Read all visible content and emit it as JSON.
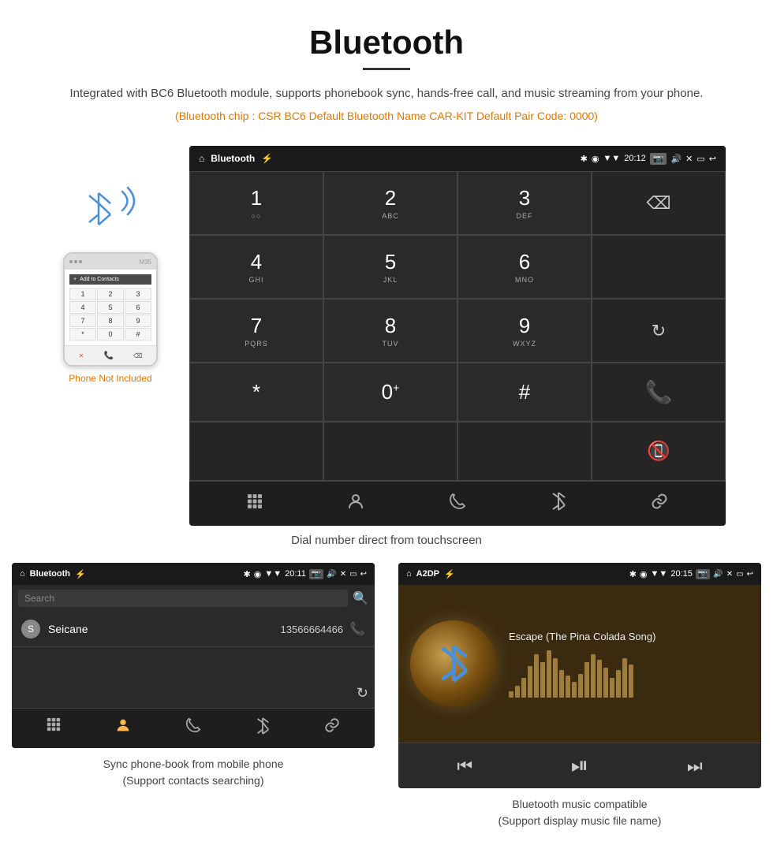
{
  "header": {
    "title": "Bluetooth",
    "description": "Integrated with BC6 Bluetooth module, supports phonebook sync, hands-free call, and music streaming from your phone.",
    "info_line": "(Bluetooth chip : CSR BC6    Default Bluetooth Name CAR-KIT    Default Pair Code: 0000)"
  },
  "car_screen": {
    "status_bar": {
      "app_name": "Bluetooth",
      "time": "20:12",
      "usb_icon": "⚡",
      "bt_icon": "✱",
      "location_icon": "◉",
      "signal_icon": "▼",
      "camera_icon": "📷",
      "volume_icon": "🔊",
      "close_icon": "✕",
      "window_icon": "▭",
      "back_icon": "↩"
    },
    "dialpad": {
      "keys": [
        {
          "num": "1",
          "sub": ""
        },
        {
          "num": "2",
          "sub": "ABC"
        },
        {
          "num": "3",
          "sub": "DEF"
        },
        {
          "num": "",
          "sub": "",
          "type": "backspace"
        },
        {
          "num": "4",
          "sub": "GHI"
        },
        {
          "num": "5",
          "sub": "JKL"
        },
        {
          "num": "6",
          "sub": "MNO"
        },
        {
          "num": "",
          "sub": "",
          "type": "empty"
        },
        {
          "num": "7",
          "sub": "PQRS"
        },
        {
          "num": "8",
          "sub": "TUV"
        },
        {
          "num": "9",
          "sub": "WXYZ"
        },
        {
          "num": "",
          "sub": "",
          "type": "refresh"
        },
        {
          "num": "*",
          "sub": ""
        },
        {
          "num": "0",
          "sub": "+"
        },
        {
          "num": "#",
          "sub": ""
        },
        {
          "num": "",
          "sub": "",
          "type": "call_green"
        }
      ]
    },
    "toolbar": {
      "dialpad_icon": "⣿",
      "person_icon": "👤",
      "phone_icon": "📞",
      "bluetooth_icon": "✱",
      "link_icon": "🔗"
    }
  },
  "phone_illustration": {
    "not_included": "Phone Not Included",
    "app_label": "Add to Contacts"
  },
  "main_caption": "Dial number direct from touchscreen",
  "phonebook_screen": {
    "status_bar": {
      "app_name": "Bluetooth",
      "time": "20:11"
    },
    "search_placeholder": "Search",
    "contacts": [
      {
        "letter": "S",
        "name": "Seicane",
        "number": "13566664466"
      }
    ],
    "caption": "Sync phone-book from mobile phone\n(Support contacts searching)"
  },
  "music_screen": {
    "status_bar": {
      "app_name": "A2DP",
      "time": "20:15"
    },
    "song_title": "Escape (The Pina Colada Song)",
    "viz_bars": [
      8,
      15,
      25,
      40,
      55,
      45,
      60,
      50,
      35,
      28,
      20,
      30,
      45,
      55,
      48,
      38,
      25,
      35,
      50,
      42
    ],
    "caption": "Bluetooth music compatible\n(Support display music file name)"
  }
}
